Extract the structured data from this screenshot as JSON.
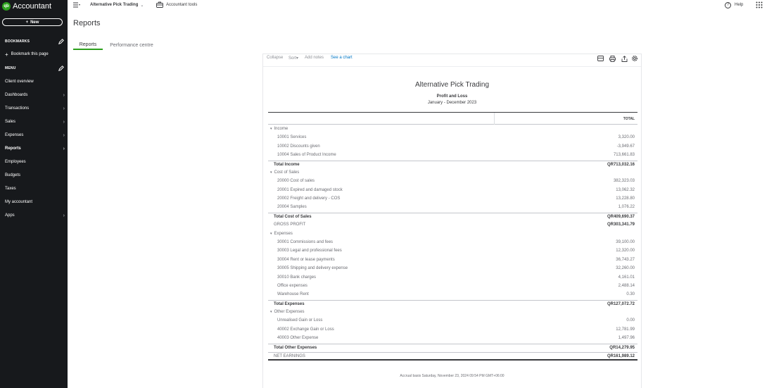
{
  "app": {
    "brand": "Accountant",
    "logo": "qb"
  },
  "sidebar": {
    "new_label": "New",
    "bookmarks_label": "BOOKMARKS",
    "bookmark_page_label": "Bookmark this page",
    "menu_label": "MENU",
    "items": [
      {
        "label": "Client overview",
        "chevron": false,
        "active": false
      },
      {
        "label": "Dashboards",
        "chevron": true,
        "active": false
      },
      {
        "label": "Transactions",
        "chevron": true,
        "active": false
      },
      {
        "label": "Sales",
        "chevron": true,
        "active": false
      },
      {
        "label": "Expenses",
        "chevron": true,
        "active": false
      },
      {
        "label": "Reports",
        "chevron": true,
        "active": true
      },
      {
        "label": "Employees",
        "chevron": false,
        "active": false
      },
      {
        "label": "Budgets",
        "chevron": false,
        "active": false
      },
      {
        "label": "Taxes",
        "chevron": false,
        "active": false
      },
      {
        "label": "My accountant",
        "chevron": false,
        "active": false
      },
      {
        "label": "Apps",
        "chevron": true,
        "active": false
      }
    ]
  },
  "topbar": {
    "company_name": "Alternative Pick Trading",
    "accountant_tools": "Accountant tools",
    "help": "Help"
  },
  "page": {
    "title": "Reports",
    "tabs": [
      {
        "label": "Reports",
        "active": true
      },
      {
        "label": "Performance centre",
        "active": false
      }
    ]
  },
  "report": {
    "toolbar": {
      "collapse": "Collapse",
      "sort": "Sort",
      "add_notes": "Add notes",
      "see_chart": "See a chart"
    },
    "company": "Alternative Pick Trading",
    "title": "Profit and Loss",
    "period": "January - December 2023",
    "column_header": "TOTAL",
    "rows": [
      {
        "type": "sec",
        "label": "Income",
        "amount": ""
      },
      {
        "type": "item",
        "label": "10001 Services",
        "amount": "3,320.00"
      },
      {
        "type": "item",
        "label": "10002 Discounts given",
        "amount": "-3,949.67"
      },
      {
        "type": "item",
        "label": "10004 Sales of Product Income",
        "amount": "713,661.83"
      },
      {
        "type": "tot",
        "label": "Total Income",
        "amount": "QR713,032.16"
      },
      {
        "type": "sec",
        "label": "Cost of Sales",
        "amount": ""
      },
      {
        "type": "item",
        "label": "20000 Cost of sales",
        "amount": "382,323.03"
      },
      {
        "type": "item",
        "label": "20001 Expired and damaged stock",
        "amount": "13,062.32"
      },
      {
        "type": "item",
        "label": "20002 Freight and delivery - COS",
        "amount": "13,228.80"
      },
      {
        "type": "item",
        "label": "20004 Samples",
        "amount": "1,076.22"
      },
      {
        "type": "tot",
        "label": "Total Cost of Sales",
        "amount": "QR409,690.37"
      },
      {
        "type": "gp",
        "label": "GROSS PROFIT",
        "amount": "QR303,341.79"
      },
      {
        "type": "sec",
        "label": "Expenses",
        "amount": ""
      },
      {
        "type": "item",
        "label": "30001 Commissions and fees",
        "amount": "39,100.00"
      },
      {
        "type": "item",
        "label": "30003 Legal and professional fees",
        "amount": "12,320.00"
      },
      {
        "type": "item",
        "label": "30004 Rent or lease payments",
        "amount": "36,743.27"
      },
      {
        "type": "item",
        "label": "30005 Shipping and delivery expense",
        "amount": "32,260.00"
      },
      {
        "type": "item",
        "label": "30010 Bank charges",
        "amount": "4,161.01"
      },
      {
        "type": "item",
        "label": "Office expenses",
        "amount": "2,488.14"
      },
      {
        "type": "item",
        "label": "Warehouse Rent",
        "amount": "0.30"
      },
      {
        "type": "tot",
        "label": "Total Expenses",
        "amount": "QR127,072.72"
      },
      {
        "type": "sec",
        "label": "Other Expenses",
        "amount": ""
      },
      {
        "type": "item",
        "label": "Unrealised Gain or Loss",
        "amount": "0.00"
      },
      {
        "type": "item",
        "label": "40002 Exchange Gain or Loss",
        "amount": "12,781.99"
      },
      {
        "type": "item",
        "label": "40003 Other Expense",
        "amount": "1,497.96"
      },
      {
        "type": "tot",
        "label": "Total Other Expenses",
        "amount": "QR14,279.95"
      },
      {
        "type": "net",
        "label": "NET EARNINGS",
        "amount": "QR161,989.12"
      }
    ],
    "footer": "Accrual basis  Saturday, November 23, 2024  09:54 PM GMT+06:00"
  },
  "colors": {
    "sidebar_bg": "#17191c",
    "brand_green": "#2ca01c",
    "link_blue": "#0077c5"
  }
}
